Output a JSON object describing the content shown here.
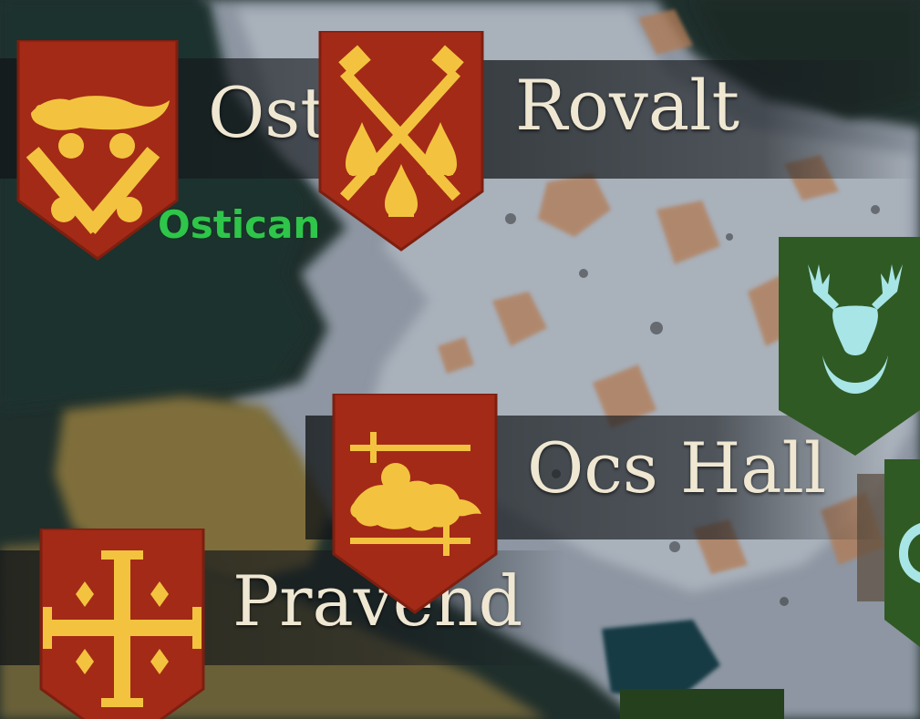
{
  "settlements": {
    "ostican": {
      "label": "Ostican",
      "owner_tag": "Ostican",
      "banner_color": "#a32a17",
      "emblem_color": "#f3c33f",
      "emblem_icon": "crossed-keys-with-lizard-icon"
    },
    "rovalt": {
      "label": "Rovalt",
      "banner_color": "#a32a17",
      "emblem_color": "#f3c33f",
      "emblem_icon": "crossed-keys-fleur-de-lis-icon"
    },
    "ocs_hall": {
      "label": "Ocs Hall",
      "banner_color": "#a32a17",
      "emblem_color": "#f3c33f",
      "emblem_icon": "lion-passant-with-swords-icon"
    },
    "pravend": {
      "label": "Pravend",
      "banner_color": "#a32a17",
      "emblem_color": "#f3c33f",
      "emblem_icon": "jerusalem-cross-icon"
    },
    "green_faction_1": {
      "banner_color": "#2f5a24",
      "emblem_color": "#a8e5e6",
      "emblem_icon": "stag-head-crescent-icon"
    },
    "green_faction_2": {
      "banner_color": "#2f5a24",
      "emblem_color": "#a8e5e6",
      "emblem_icon": "crescent-icon"
    }
  }
}
